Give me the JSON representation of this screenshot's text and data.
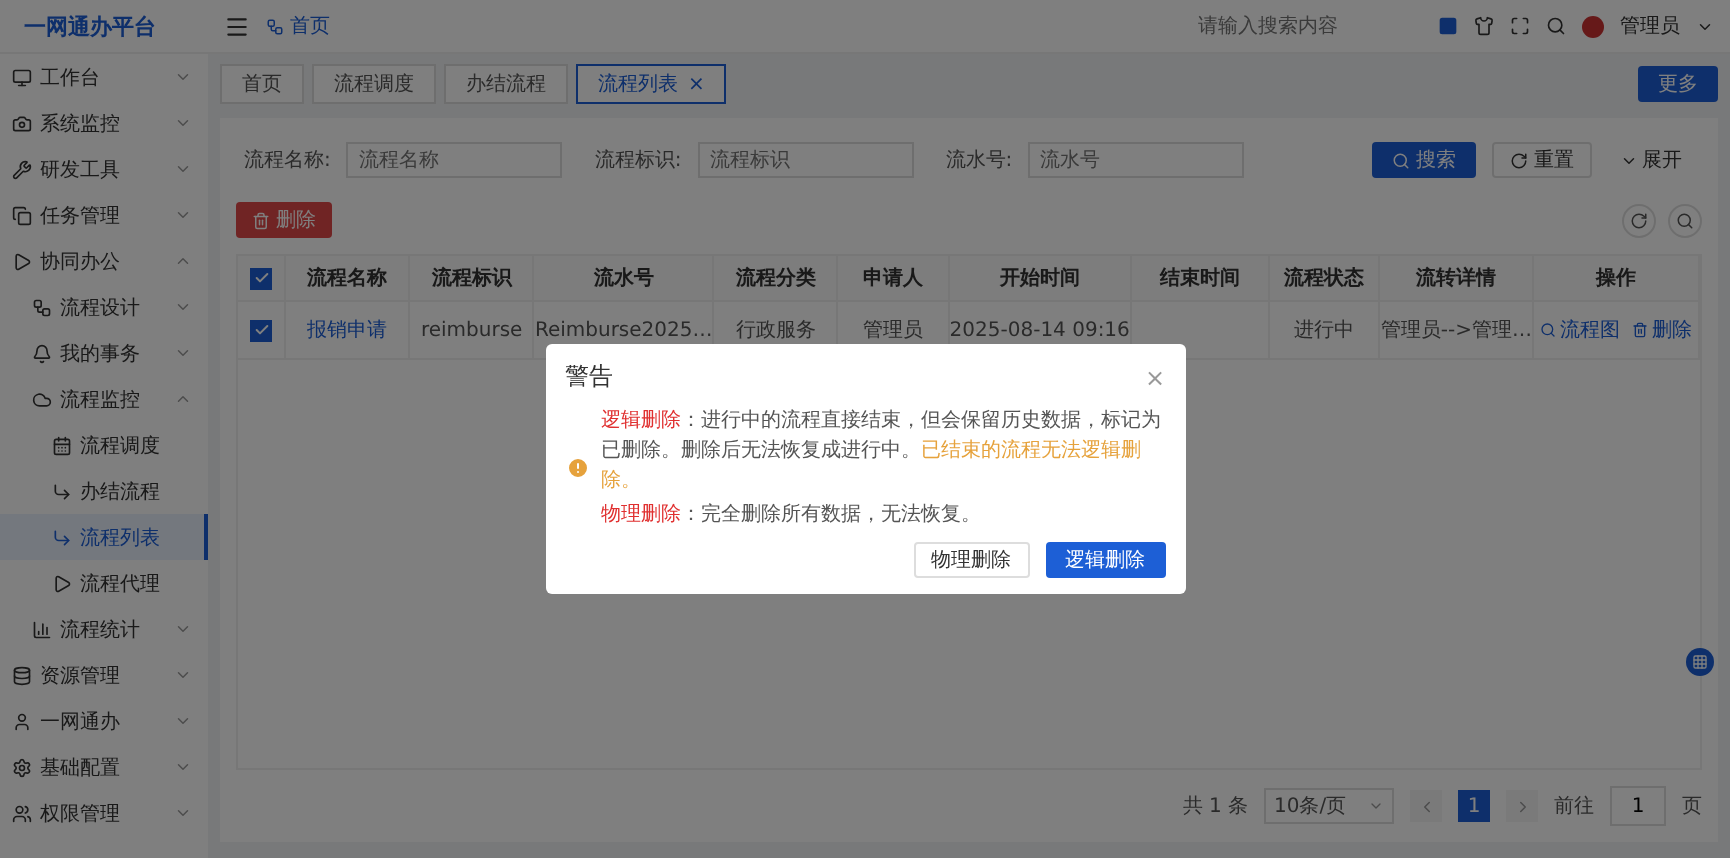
{
  "app": {
    "title": "一网通办平台"
  },
  "header": {
    "breadcrumb": "首页",
    "search": {
      "placeholder": "请输入搜索内容"
    },
    "user": "管理员"
  },
  "sidebar": {
    "items": [
      {
        "label": "工作台",
        "expanded": false,
        "selected": false
      },
      {
        "label": "系统监控",
        "expanded": false,
        "selected": false
      },
      {
        "label": "研发工具",
        "expanded": false,
        "selected": false
      },
      {
        "label": "任务管理",
        "expanded": false,
        "selected": false
      },
      {
        "label": "协同办公",
        "expanded": true,
        "selected": false,
        "children": [
          {
            "label": "流程设计",
            "expanded": false,
            "selected": false
          },
          {
            "label": "我的事务",
            "expanded": false,
            "selected": false
          },
          {
            "label": "流程监控",
            "expanded": true,
            "selected": false,
            "children": [
              {
                "label": "流程调度",
                "selected": false
              },
              {
                "label": "办结流程",
                "selected": false
              },
              {
                "label": "流程列表",
                "selected": true
              },
              {
                "label": "流程代理",
                "selected": false
              }
            ]
          },
          {
            "label": "流程统计",
            "expanded": false,
            "selected": false
          }
        ]
      },
      {
        "label": "资源管理",
        "expanded": false,
        "selected": false
      },
      {
        "label": "一网通办",
        "expanded": false,
        "selected": false
      },
      {
        "label": "基础配置",
        "expanded": false,
        "selected": false
      },
      {
        "label": "权限管理",
        "expanded": false,
        "selected": false
      }
    ]
  },
  "tabs": [
    {
      "label": "首页",
      "selected": false
    },
    {
      "label": "流程调度",
      "selected": false
    },
    {
      "label": "办结流程",
      "selected": false
    },
    {
      "label": "流程列表",
      "selected": true,
      "close": "×"
    }
  ],
  "more_button": "更多",
  "filters": [
    {
      "label": "流程名称:",
      "placeholder": "流程名称"
    },
    {
      "label": "流程标识:",
      "placeholder": "流程标识"
    },
    {
      "label": "流水号:",
      "placeholder": "流水号"
    }
  ],
  "search_button": "搜索",
  "reset_button": "重置",
  "expand_button": "展开",
  "delete_button": "删除",
  "table": {
    "header_checked": true,
    "columns": [
      "流程名称",
      "流程标识",
      "流水号",
      "流程分类",
      "申请人",
      "开始时间",
      "结束时间",
      "流程状态",
      "流转详情",
      "操作"
    ],
    "rows": [
      {
        "checked": true,
        "cells": [
          "报销申请",
          "reimburse",
          "Reimburse2025…",
          "行政服务",
          "管理员",
          "2025-08-14 09:16",
          null,
          "进行中",
          "管理员-->管理…"
        ],
        "actions": [
          "流程图",
          "删除"
        ]
      }
    ]
  },
  "pagination": {
    "total": "共 1 条",
    "page_size": "10条/页",
    "pages": [
      {
        "label": "1",
        "selected": true
      }
    ],
    "goto_label": "前往",
    "goto_value": "1",
    "page_suffix": "页"
  },
  "dialog": {
    "title": "警告",
    "close": "×",
    "paragraphs": [
      [
        {
          "text": "逻辑删除",
          "color": "#e03030"
        },
        {
          "text": "：进行中的流程直接结束，但会保留历史数据，标记为已删除。删除后无法恢复成进行中。",
          "color": "#555555"
        },
        {
          "text": "已结束的流程无法逻辑删除。",
          "color": "#e6a23c"
        }
      ],
      [
        {
          "text": "物理删除",
          "color": "#e03030"
        },
        {
          "text": "：完全删除所有数据，无法恢复。",
          "color": "#555555"
        }
      ]
    ],
    "buttons": [
      {
        "label": "物理删除",
        "kind": "default"
      },
      {
        "label": "逻辑删除",
        "kind": "primary"
      }
    ]
  }
}
